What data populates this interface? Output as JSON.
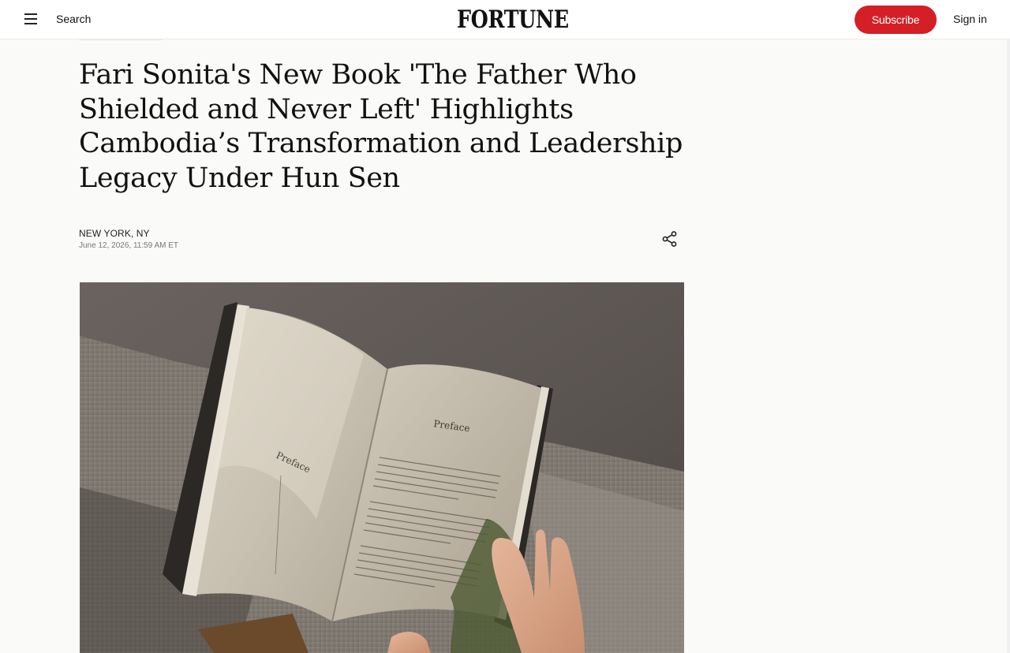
{
  "header": {
    "search_label": "Search",
    "logo_text": "FORTUNE",
    "subscribe_label": "Subscribe",
    "signin_label": "Sign in",
    "subscribe_color": "#d41f26"
  },
  "article": {
    "headline": "Fari Sonita's New Book 'The Father Who Shielded and Never Left' Highlights Cambodia’s Transformation and Leadership Legacy Under Hun Sen",
    "dateline": "NEW YORK, NY",
    "timestamp": "June 12, 2026, 11:59 AM ET"
  },
  "icons": {
    "menu": "hamburger-menu-icon",
    "share": "share-icon"
  },
  "hero_image": {
    "left_page_title": "Preface",
    "right_page_title": "Preface"
  }
}
